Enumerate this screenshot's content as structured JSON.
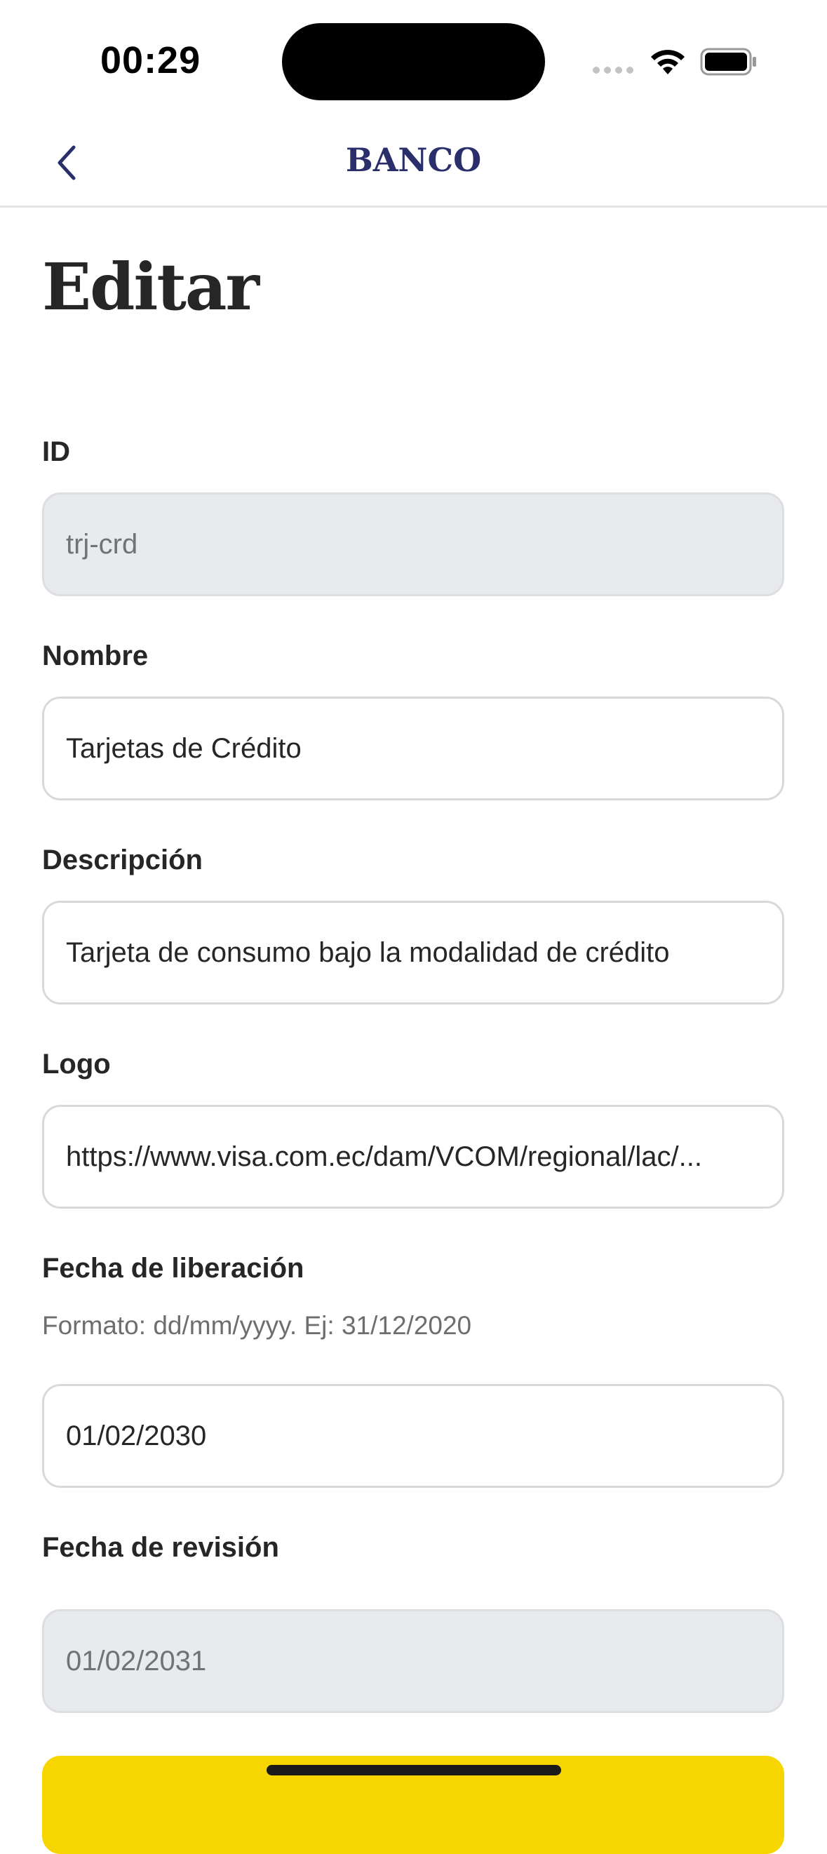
{
  "status_bar": {
    "time": "00:29",
    "icons": [
      "signal-icon",
      "wifi-icon",
      "battery-icon"
    ]
  },
  "header": {
    "back_icon": "chevron-left-icon",
    "brand": "BANCO"
  },
  "page": {
    "title": "Editar"
  },
  "form": {
    "id": {
      "label": "ID",
      "value": "trj-crd",
      "readonly": true
    },
    "nombre": {
      "label": "Nombre",
      "value": "Tarjetas de Crédito"
    },
    "descripcion": {
      "label": "Descripción",
      "value": "Tarjeta de consumo bajo la modalidad de crédito"
    },
    "logo": {
      "label": "Logo",
      "value": "https://www.visa.com.ec/dam/VCOM/regional/lac/..."
    },
    "fecha_liberacion": {
      "label": "Fecha de liberación",
      "hint": "Formato: dd/mm/yyyy. Ej: 31/12/2020",
      "value": "01/02/2030"
    },
    "fecha_revision": {
      "label": "Fecha de revisión",
      "value": "01/02/2031",
      "readonly": true
    }
  },
  "colors": {
    "brand": "#2a2f6b",
    "primary_button": "#f7d500",
    "readonly_bg": "#e8eaee"
  }
}
